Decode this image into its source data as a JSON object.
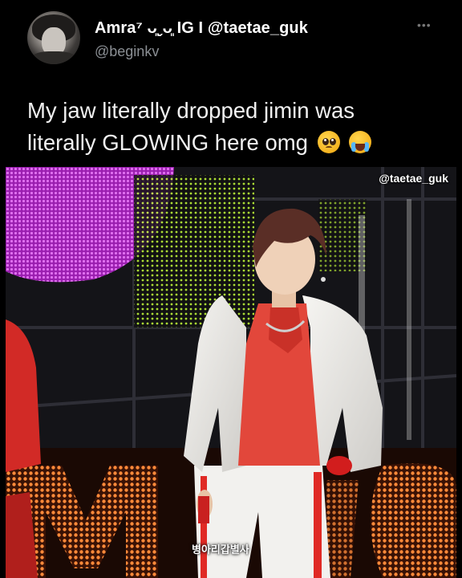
{
  "tweet": {
    "display_name": "Amra⁷ ᴗ͈ˬᴗ͈ IG I @taetae_guk",
    "handle": "@beginkv",
    "more_icon": "more-horizontal-icon",
    "text_line1": "My jaw literally dropped jimin was",
    "text_line2": "literally GLOWING here omg",
    "emojis": [
      "pleading-face-emoji",
      "loudly-crying-face-emoji"
    ]
  },
  "media": {
    "watermark": "@taetae_guk",
    "caption": "병아리갑별사",
    "description_colors": {
      "stage_magenta": "#c43bd6",
      "led_lime": "#c4ff3a",
      "jacket_white": "#ecebe8",
      "shirt_red": "#e2473b",
      "led_orange": "#ff7a2e"
    }
  }
}
